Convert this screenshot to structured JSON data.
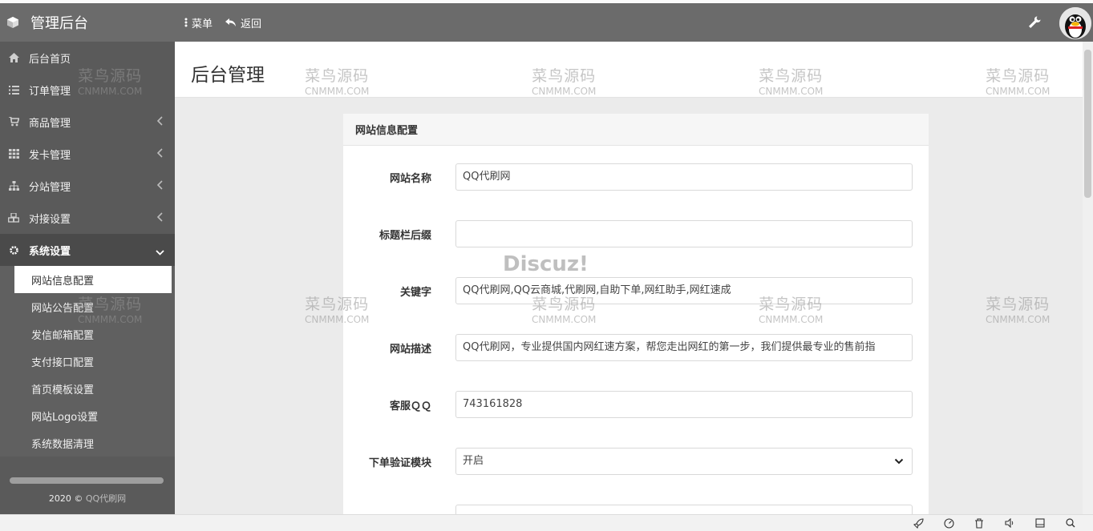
{
  "app": {
    "title": "管理后台"
  },
  "topnav": {
    "menu_label": "菜单",
    "back_label": "返回"
  },
  "sidebar": {
    "items": [
      {
        "label": "后台首页",
        "icon": "home-icon"
      },
      {
        "label": "订单管理",
        "icon": "list-icon"
      },
      {
        "label": "商品管理",
        "icon": "cart-icon"
      },
      {
        "label": "发卡管理",
        "icon": "grid-icon"
      },
      {
        "label": "分站管理",
        "icon": "sitemap-icon"
      },
      {
        "label": "对接设置",
        "icon": "cubes-icon"
      },
      {
        "label": "系统设置",
        "icon": "gear-icon"
      }
    ],
    "sub_items": [
      "网站信息配置",
      "网站公告配置",
      "发信邮箱配置",
      "支付接口配置",
      "首页模板设置",
      "网站Logo设置",
      "系统数据清理"
    ],
    "footer_year": "2020 ©",
    "footer_link": "QQ代刷网"
  },
  "page": {
    "title": "后台管理"
  },
  "card": {
    "title": "网站信息配置",
    "fields": [
      {
        "label": "网站名称",
        "value": "QQ代刷网"
      },
      {
        "label": "标题栏后缀",
        "value": ""
      },
      {
        "label": "关键字",
        "value": "QQ代刷网,QQ云商城,代刷网,自助下单,网红助手,网红速成"
      },
      {
        "label": "网站描述",
        "value": "QQ代刷网，专业提供国内网红速方案，帮您走出网红的第一步，我们提供最专业的售前指"
      },
      {
        "label": "客服ＱＱ",
        "value": "743161828"
      },
      {
        "label": "下单验证模块",
        "value": "开启"
      }
    ]
  },
  "watermark": {
    "text": "菜鸟源码",
    "domain": "CNMMM.COM",
    "discuz": "Discuz!"
  }
}
